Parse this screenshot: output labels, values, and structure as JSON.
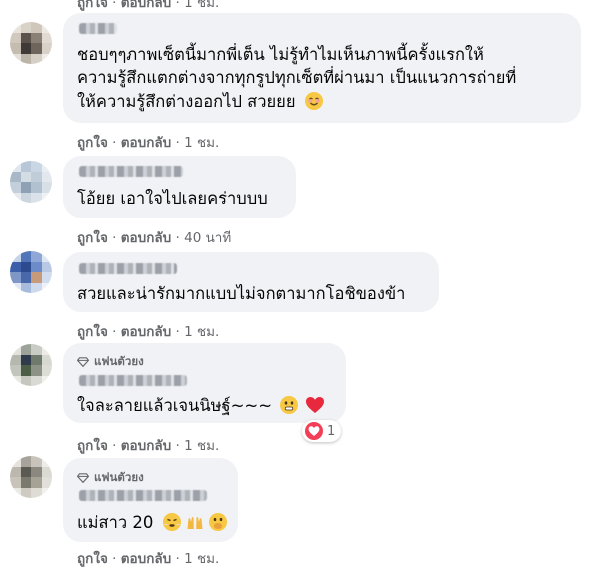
{
  "comments": [
    {
      "text_lines": [
        "ชอบๆๆภาพเซ็ตนี้มากพี่เต็น ไม่รู้ทำไมเห็นภาพนี้ครั้งแรกให้",
        "ความรู้สึกแตกต่างจากทุกรูปทุกเซ็ตที่ผ่านมา เป็นแนวการถ่ายที่",
        "ให้ความรู้สึกต่างออกไป สวยยย"
      ],
      "emoji": "smiling-face-icon",
      "like": "ถูกใจ",
      "reply": "ตอบกลับ",
      "time": "1 ชม."
    },
    {
      "text_lines": [
        "โอ้ยย เอาใจไปเลยคร่าบบบ"
      ],
      "like": "ถูกใจ",
      "reply": "ตอบกลับ",
      "time": "40 นาที"
    },
    {
      "text_lines": [
        "สวยและน่ารักมากแบบไม่จกตามากโอชิของข้า"
      ],
      "like": "ถูกใจ",
      "reply": "ตอบกลับ",
      "time": "1 ชม."
    },
    {
      "badge": "แฟนตัวยง",
      "text_lines": [
        "ใจละลายแล้วเจนนิษฐ์~~~"
      ],
      "reaction_count": "1",
      "like": "ถูกใจ",
      "reply": "ตอบกลับ",
      "time": "1 ชม."
    },
    {
      "badge": "แฟนตัวยง",
      "text_lines": [
        "แม่สาว 20"
      ],
      "like": "ถูกใจ",
      "reply": "ตอบกลับ",
      "time": "1 ชม."
    }
  ],
  "colors": {
    "bubble": "#f0f2f5",
    "meta": "#65676b",
    "heart": "#f33e58"
  }
}
